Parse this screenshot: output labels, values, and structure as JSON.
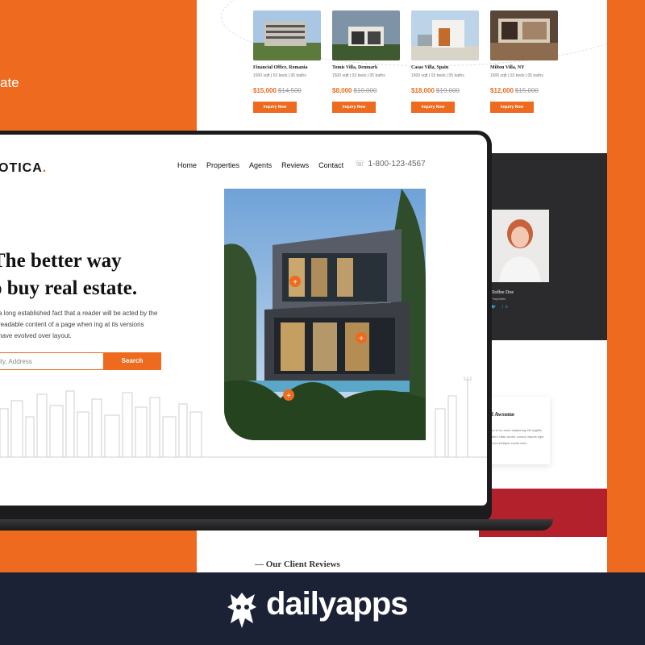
{
  "side_text": "ate",
  "listings": [
    {
      "title": "Financial Office, Romania",
      "meta": "1500 sqft | 03 beds | 05 baths",
      "price": "$15,000",
      "old_price": "$14,500",
      "button": "Inquiry Now"
    },
    {
      "title": "Tomis Villa, Denmark",
      "meta": "1500 sqft | 03 beds | 05 baths",
      "price": "$8,000",
      "old_price": "$10,000",
      "button": "Inquiry Now"
    },
    {
      "title": "Casas Villa, Spain",
      "meta": "1500 sqft | 03 beds | 05 baths",
      "price": "$18,000",
      "old_price": "$19,000",
      "button": "Inquiry Now"
    },
    {
      "title": "Milton Villa, NY",
      "meta": "1500 sqft | 03 beds | 05 baths",
      "price": "$12,000",
      "old_price": "$15,000",
      "button": "Inquiry Now"
    }
  ],
  "agent": {
    "name": "Doffee Doe",
    "role": "Properties",
    "social": "🐦 in"
  },
  "review_card": {
    "title": "ll Awsome",
    "text": "em et se amet adipiscing elit sagittis libero vitae auctor cursus mauris eget tortor tristique sociis nunc."
  },
  "reviews_heading": "— Our Client Reviews",
  "site": {
    "brand": "OTICA",
    "brand_dot": ".",
    "nav": [
      "Home",
      "Properties",
      "Agents",
      "Reviews",
      "Contact"
    ],
    "phone_icon": "phone-icon",
    "phone": "1-800-123-4567",
    "hero_line1": "The better way",
    "hero_line2": "o buy real estate.",
    "hero_sub": "a long established fact that a reader will be acted by the readable content of a page when ing at its versions have evolved over layout.",
    "search_placeholder": "ity, Address",
    "search_button": "Search"
  },
  "banner": {
    "logo_text": "dailyapps"
  },
  "colors": {
    "accent": "#ed6a1f",
    "dark": "#2b2b2d",
    "banner": "#1c2236",
    "red": "#b3212d"
  }
}
